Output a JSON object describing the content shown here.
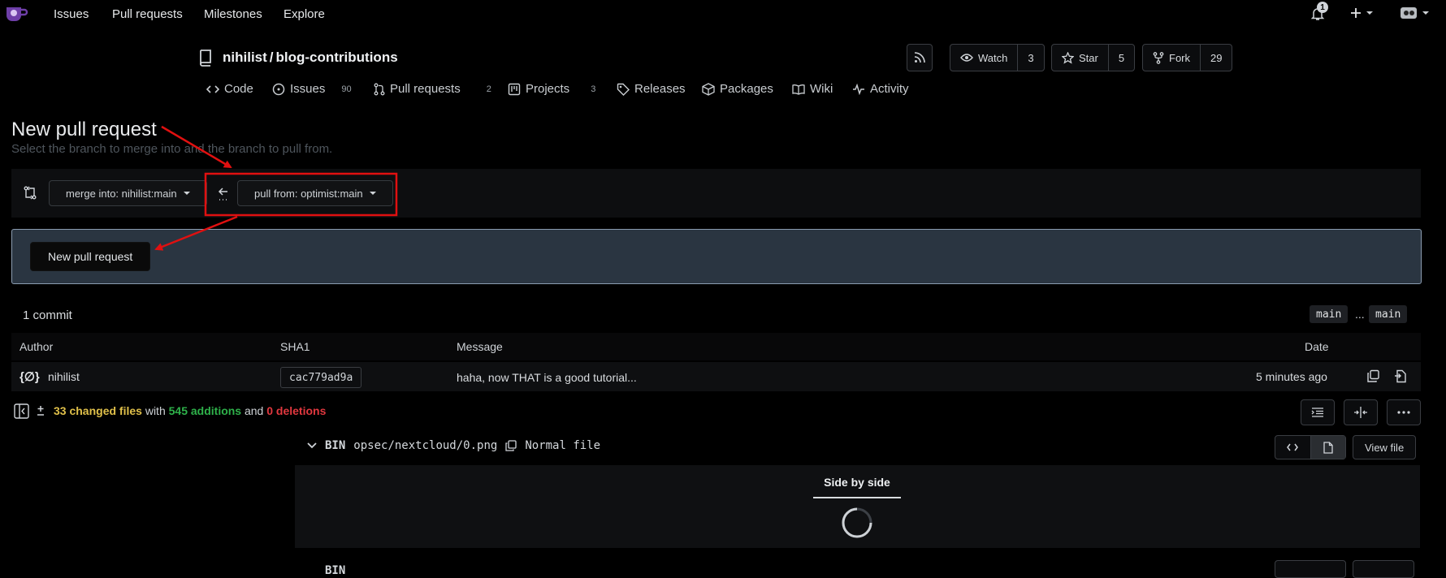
{
  "nav": {
    "items": [
      "Issues",
      "Pull requests",
      "Milestones",
      "Explore"
    ],
    "notif_count": "1"
  },
  "repo": {
    "owner": "nihilist",
    "sep": "/",
    "name": "blog-contributions",
    "watch_label": "Watch",
    "watch_count": "3",
    "star_label": "Star",
    "star_count": "5",
    "fork_label": "Fork",
    "fork_count": "29"
  },
  "tabs": [
    {
      "label": "Code",
      "count": ""
    },
    {
      "label": "Issues",
      "count": "90"
    },
    {
      "label": "Pull requests",
      "count": "2"
    },
    {
      "label": "Projects",
      "count": "3"
    },
    {
      "label": "Releases",
      "count": ""
    },
    {
      "label": "Packages",
      "count": ""
    },
    {
      "label": "Wiki",
      "count": ""
    },
    {
      "label": "Activity",
      "count": ""
    }
  ],
  "page": {
    "title": "New pull request",
    "subtitle": "Select the branch to merge into and the branch to pull from.",
    "merge_into": "merge into: nihilist:main",
    "pull_from": "pull from: optimist:main",
    "new_pr_button": "New pull request"
  },
  "commits": {
    "count_label": "1 commit",
    "base_ref": "main",
    "dots": "...",
    "head_ref": "main",
    "headers": {
      "author": "Author",
      "sha": "SHA1",
      "message": "Message",
      "date": "Date"
    },
    "rows": [
      {
        "author": "nihilist",
        "avatar": "{∅}",
        "sha": "cac779ad9a",
        "message": "haha, now THAT is a good tutorial...",
        "date": "5 minutes ago"
      }
    ]
  },
  "diff": {
    "changed": "33 changed files",
    "with": "with",
    "additions": "545 additions",
    "and": "and",
    "deletions": "0 deletions",
    "file": {
      "type": "BIN",
      "path": "opsec/nextcloud/0.png",
      "mode": "Normal file",
      "view_label": "View file",
      "tab": "Side by side"
    },
    "next_file_type": "BIN"
  },
  "colors": {
    "annotation": "#e01010",
    "pr_box_bg": "#2a3541",
    "additions": "#2eb14a",
    "deletions": "#e2383f"
  }
}
